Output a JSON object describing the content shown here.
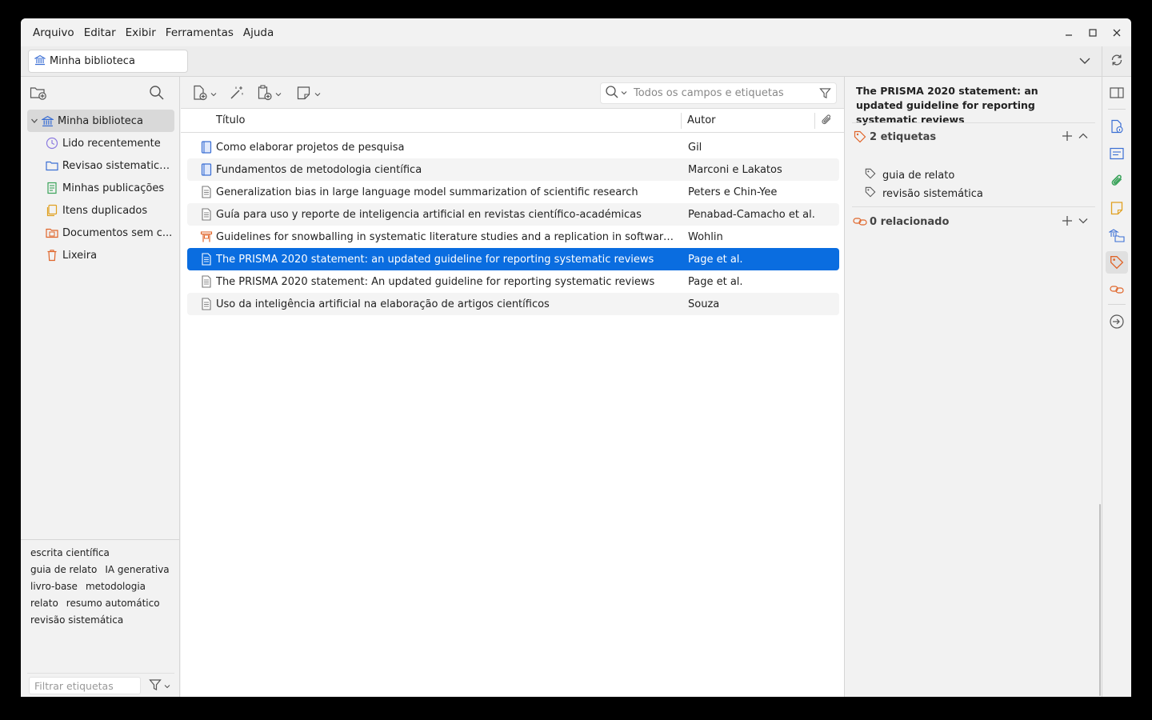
{
  "menu": [
    "Arquivo",
    "Editar",
    "Exibir",
    "Ferramentas",
    "Ajuda"
  ],
  "tab": {
    "label": "Minha biblioteca"
  },
  "collections": [
    {
      "label": "Minha biblioteca",
      "icon": "library-icon",
      "selected": true
    },
    {
      "label": "Lido recentemente",
      "icon": "clock-icon"
    },
    {
      "label": "Revisao sistematica...",
      "icon": "folder-icon"
    },
    {
      "label": "Minhas publicações",
      "icon": "publications-icon"
    },
    {
      "label": "Itens duplicados",
      "icon": "duplicate-icon"
    },
    {
      "label": "Documentos sem c...",
      "icon": "unfiled-icon"
    },
    {
      "label": "Lixeira",
      "icon": "trash-icon"
    }
  ],
  "tags": [
    "escrita científica",
    "guia de relato",
    "IA generativa",
    "livro-base",
    "metodologia",
    "relato",
    "resumo automático",
    "revisão sistemática"
  ],
  "tag_filter_placeholder": "Filtrar etiquetas",
  "search_placeholder": "Todos os campos e etiquetas",
  "columns": {
    "title": "Título",
    "author": "Autor"
  },
  "items": [
    {
      "title": "Como elaborar projetos de pesquisa",
      "author": "Gil",
      "type": "book"
    },
    {
      "title": "Fundamentos de metodologia científica",
      "author": "Marconi e Lakatos",
      "type": "book"
    },
    {
      "title": "Generalization bias in large language model summarization of scientific research",
      "author": "Peters e Chin-Yee",
      "type": "article"
    },
    {
      "title": "Guía para uso y reporte de inteligencia artificial en revistas científico-académicas",
      "author": "Penabad-Camacho et al.",
      "type": "article"
    },
    {
      "title": "Guidelines for snowballing in systematic literature studies and a replication in software engineering",
      "author": "Wohlin",
      "type": "conference"
    },
    {
      "title": "The PRISMA 2020 statement: an updated guideline for reporting systematic reviews",
      "author": "Page et al.",
      "type": "article",
      "selected": true
    },
    {
      "title": "The PRISMA 2020 statement: An updated guideline for reporting systematic reviews",
      "author": "Page et al.",
      "type": "article"
    },
    {
      "title": "Uso da inteligência artificial na elaboração de artigos científicos",
      "author": "Souza",
      "type": "article"
    }
  ],
  "detail": {
    "title": "The PRISMA 2020 statement: an updated guideline for reporting systematic reviews",
    "tags_header": "2 etiquetas",
    "tags": [
      "guia de relato",
      "revisão sistemática"
    ],
    "related_header": "0 relacionado"
  },
  "colors": {
    "selection": "#0a6de0",
    "accent_blue": "#3b6fd4",
    "tag_orange": "#e0652a"
  }
}
